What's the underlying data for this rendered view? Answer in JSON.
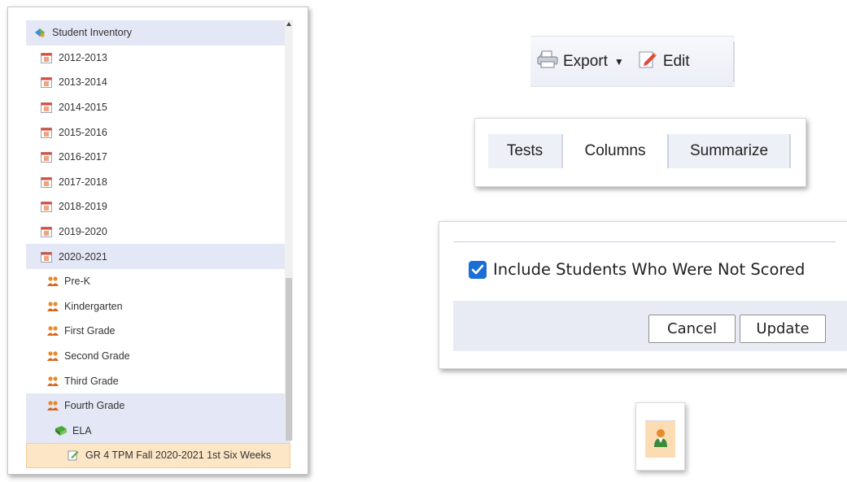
{
  "tree": {
    "root_label": "Student Inventory",
    "years": [
      "2012-2013",
      "2013-2014",
      "2014-2015",
      "2015-2016",
      "2016-2017",
      "2017-2018",
      "2018-2019",
      "2019-2020",
      "2020-2021"
    ],
    "grades": [
      "Pre-K",
      "Kindergarten",
      "First Grade",
      "Second Grade",
      "Third Grade",
      "Fourth Grade"
    ],
    "subject": "ELA",
    "test": "GR 4 TPM Fall 2020-2021 1st Six Weeks",
    "calendar_icon_text": "12"
  },
  "toolbar": {
    "export_label": "Export",
    "edit_label": "Edit"
  },
  "tabs": {
    "tests_label": "Tests",
    "columns_label": "Columns",
    "summarize_label": "Summarize"
  },
  "options": {
    "include_unscored_label": "Include Students Who Were Not Scored",
    "include_unscored_checked": true,
    "cancel_label": "Cancel",
    "update_label": "Update"
  },
  "colors": {
    "selected_row": "#e4e7f5",
    "active_row": "#fde6c6",
    "checkbox": "#1a6fd6",
    "footer": "#e8ebf3"
  }
}
